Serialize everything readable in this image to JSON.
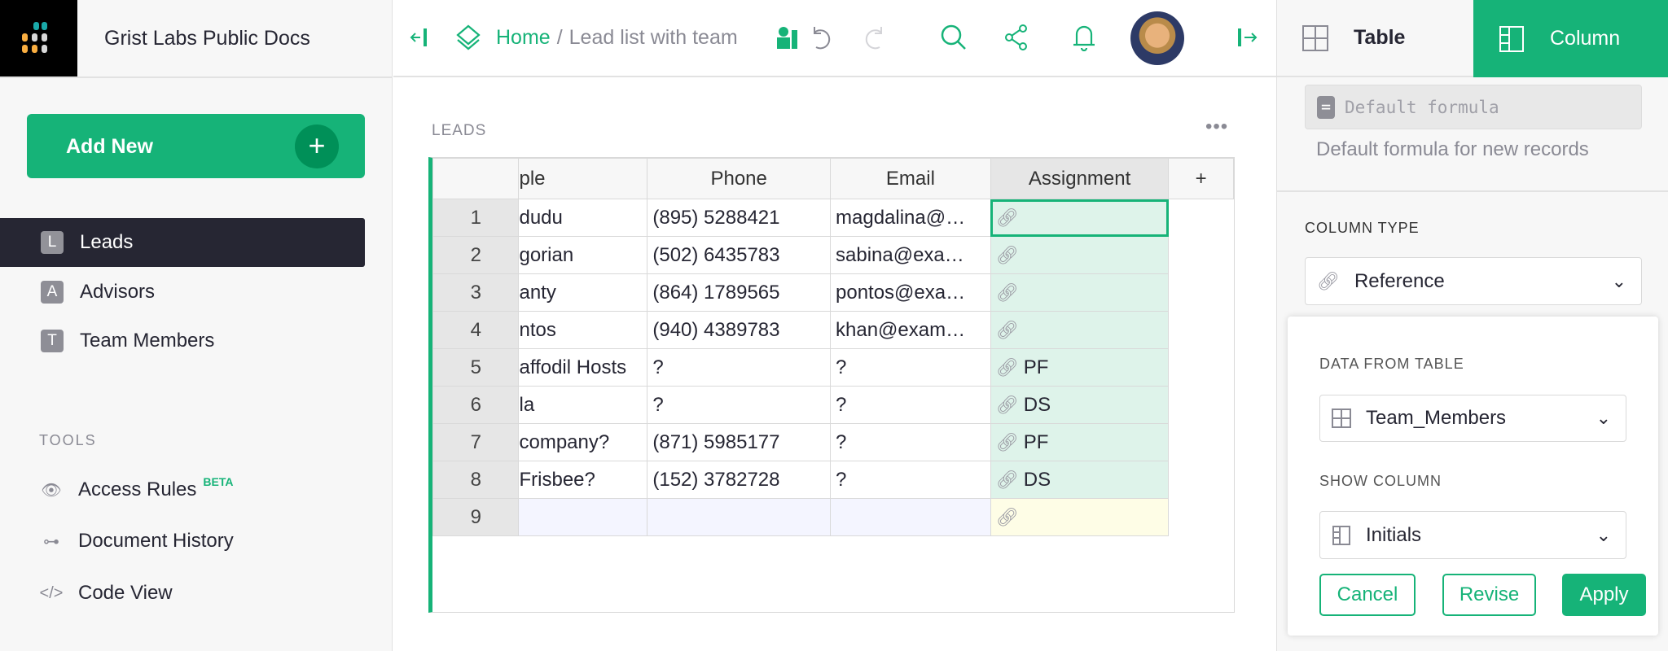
{
  "org": {
    "name": "Grist Labs Public Docs"
  },
  "sidebar": {
    "add_new": "Add New",
    "pages": [
      {
        "badge": "L",
        "label": "Leads"
      },
      {
        "badge": "A",
        "label": "Advisors"
      },
      {
        "badge": "T",
        "label": "Team Members"
      }
    ],
    "tools_heading": "TOOLS",
    "tools": [
      {
        "label": "Access Rules",
        "badge": "BETA"
      },
      {
        "label": "Document History"
      },
      {
        "label": "Code View"
      }
    ]
  },
  "header": {
    "home": "Home",
    "separator": "/",
    "doc_title": "Lead list with team"
  },
  "section": {
    "title": "LEADS",
    "menu": "•••"
  },
  "table": {
    "columns": [
      "ple",
      "Phone",
      "Email",
      "Assignment",
      "+"
    ],
    "rows": [
      {
        "n": "1",
        "name": "dudu",
        "phone": "(895) 5288421",
        "email": "magdalina@…",
        "assign": ""
      },
      {
        "n": "2",
        "name": "gorian",
        "phone": "(502) 6435783",
        "email": "sabina@exa…",
        "assign": ""
      },
      {
        "n": "3",
        "name": "anty",
        "phone": "(864) 1789565",
        "email": "pontos@exa…",
        "assign": ""
      },
      {
        "n": "4",
        "name": "ntos",
        "phone": "(940) 4389783",
        "email": "khan@exam…",
        "assign": ""
      },
      {
        "n": "5",
        "name": "affodil Hosts",
        "phone": "?",
        "email": "?",
        "assign": "PF"
      },
      {
        "n": "6",
        "name": "la",
        "phone": "?",
        "email": "?",
        "assign": "DS"
      },
      {
        "n": "7",
        "name": "company?",
        "phone": "(871) 5985177",
        "email": "?",
        "assign": "PF"
      },
      {
        "n": "8",
        "name": "Frisbee?",
        "phone": "(152) 3782728",
        "email": "?",
        "assign": "DS"
      },
      {
        "n": "9",
        "name": "",
        "phone": "",
        "email": "",
        "assign": ""
      }
    ]
  },
  "panel": {
    "tab_table": "Table",
    "tab_column": "Column",
    "formula_placeholder": "Default formula",
    "formula_help": "Default formula for new records",
    "column_type_label": "COLUMN TYPE",
    "column_type": "Reference",
    "data_from_label": "DATA FROM TABLE",
    "data_from": "Team_Members",
    "show_column_label": "SHOW COLUMN",
    "show_column": "Initials",
    "cancel": "Cancel",
    "revise": "Revise",
    "apply": "Apply"
  },
  "colors": {
    "accent": "#16b378",
    "dark": "#262633"
  }
}
